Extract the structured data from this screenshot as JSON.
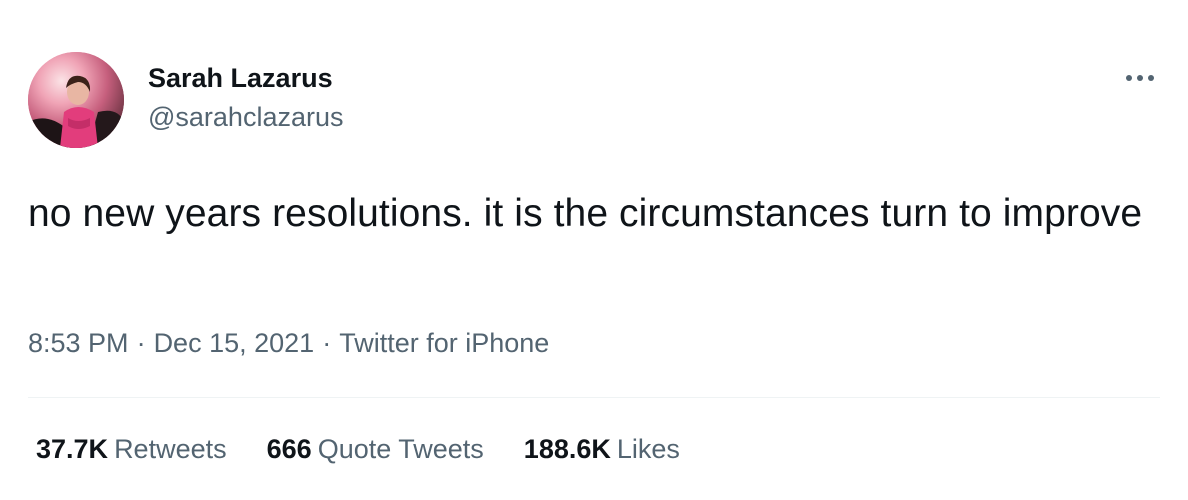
{
  "author": {
    "display_name": "Sarah Lazarus",
    "handle": "@sarahclazarus",
    "avatar_icon": "profile-photo"
  },
  "menu": {
    "icon": "more-horizontal-icon"
  },
  "tweet": {
    "text": "no new years resolutions. it is the circumstances turn to improve"
  },
  "meta": {
    "time": "8:53 PM",
    "separator": "·",
    "date": "Dec 15, 2021",
    "source": "Twitter for iPhone"
  },
  "stats": {
    "retweets": {
      "count": "37.7K",
      "label": "Retweets"
    },
    "quote_tweets": {
      "count": "666",
      "label": "Quote Tweets"
    },
    "likes": {
      "count": "188.6K",
      "label": "Likes"
    }
  },
  "colors": {
    "primary_text": "#0f1419",
    "secondary_text": "#536471",
    "divider": "#eff3f4"
  }
}
